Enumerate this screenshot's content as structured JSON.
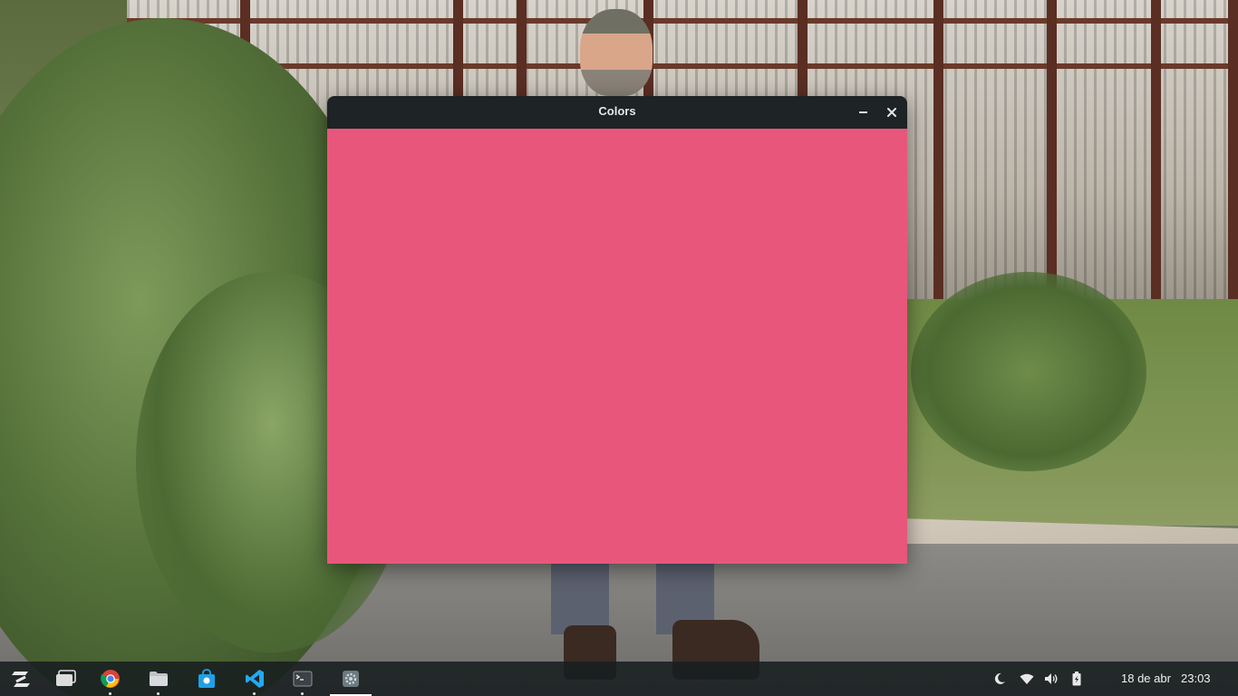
{
  "window": {
    "title": "Colors",
    "canvas_color": "#e8577b",
    "titlebar_color": "#1e2325"
  },
  "taskbar": {
    "launcher": {
      "icon": "zorin-menu-icon"
    },
    "apps": [
      {
        "name": "workspace-switcher",
        "icon": "windows-icon",
        "running": false
      },
      {
        "name": "chrome",
        "icon": "chrome-icon",
        "running": true
      },
      {
        "name": "files",
        "icon": "folder-icon",
        "running": true
      },
      {
        "name": "software-store",
        "icon": "store-bag-icon",
        "running": false
      },
      {
        "name": "vscode",
        "icon": "vscode-icon",
        "running": true
      },
      {
        "name": "terminal",
        "icon": "terminal-icon",
        "running": true
      },
      {
        "name": "colors-app",
        "icon": "gear-icon",
        "running": true,
        "active": true
      }
    ],
    "tray": {
      "icons": [
        "night-light-icon",
        "wifi-icon",
        "volume-icon",
        "battery-icon"
      ],
      "date": "18 de abr",
      "time": "23:03"
    }
  }
}
